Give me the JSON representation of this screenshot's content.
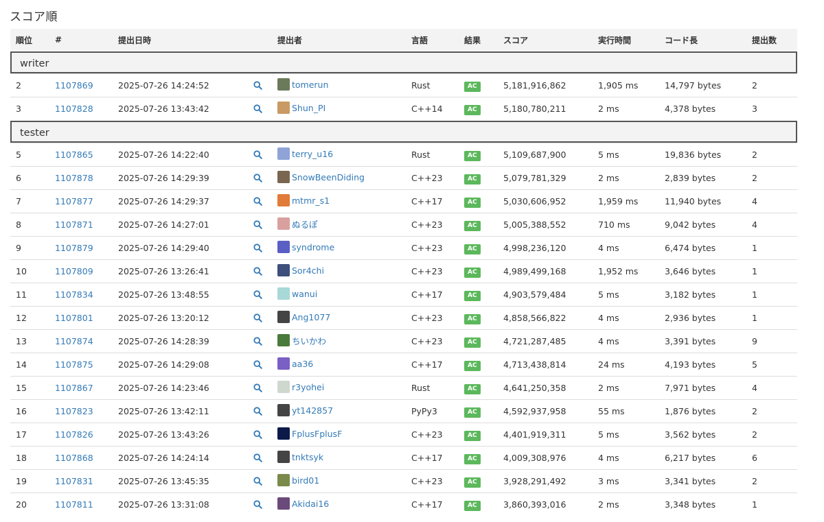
{
  "page_title": "スコア順",
  "columns": [
    "順位",
    "#",
    "提出日時",
    "",
    "提出者",
    "言語",
    "結果",
    "スコア",
    "実行時間",
    "コード長",
    "提出数"
  ],
  "groups": [
    {
      "label": "writer",
      "rows": [
        {
          "rank": "2",
          "id": "1107869",
          "date": "2025-07-26 14:24:52",
          "user": "tomerun",
          "avatar_color": "#6b7a5a",
          "lang": "Rust",
          "result": "AC",
          "score": "5,181,916,862",
          "time": "1,905 ms",
          "length": "14,797 bytes",
          "count": "2"
        },
        {
          "rank": "3",
          "id": "1107828",
          "date": "2025-07-26 13:43:42",
          "user": "Shun_PI",
          "avatar_color": "#c99a63",
          "lang": "C++14",
          "result": "AC",
          "score": "5,180,780,211",
          "time": "2 ms",
          "length": "4,378 bytes",
          "count": "3"
        }
      ]
    },
    {
      "label": "tester",
      "rows": [
        {
          "rank": "5",
          "id": "1107865",
          "date": "2025-07-26 14:22:40",
          "user": "terry_u16",
          "avatar_color": "#8fa3d6",
          "lang": "Rust",
          "result": "AC",
          "score": "5,109,687,900",
          "time": "5 ms",
          "length": "19,836 bytes",
          "count": "2"
        },
        {
          "rank": "6",
          "id": "1107878",
          "date": "2025-07-26 14:29:39",
          "user": "SnowBeenDiding",
          "avatar_color": "#7a6650",
          "lang": "C++23",
          "result": "AC",
          "score": "5,079,781,329",
          "time": "2 ms",
          "length": "2,839 bytes",
          "count": "2"
        },
        {
          "rank": "7",
          "id": "1107877",
          "date": "2025-07-26 14:29:37",
          "user": "mtmr_s1",
          "avatar_color": "#e07b39",
          "lang": "C++17",
          "result": "AC",
          "score": "5,030,606,952",
          "time": "1,959 ms",
          "length": "11,940 bytes",
          "count": "4"
        },
        {
          "rank": "8",
          "id": "1107871",
          "date": "2025-07-26 14:27:01",
          "user": "ぬるぽ",
          "avatar_color": "#d9a0a0",
          "lang": "C++23",
          "result": "AC",
          "score": "5,005,388,552",
          "time": "710 ms",
          "length": "9,042 bytes",
          "count": "4"
        },
        {
          "rank": "9",
          "id": "1107879",
          "date": "2025-07-26 14:29:40",
          "user": "syndrome",
          "avatar_color": "#5a5fc4",
          "lang": "C++23",
          "result": "AC",
          "score": "4,998,236,120",
          "time": "4 ms",
          "length": "6,474 bytes",
          "count": "1"
        },
        {
          "rank": "10",
          "id": "1107809",
          "date": "2025-07-26 13:26:41",
          "user": "Sor4chi",
          "avatar_color": "#3d4f7a",
          "lang": "C++23",
          "result": "AC",
          "score": "4,989,499,168",
          "time": "1,952 ms",
          "length": "3,646 bytes",
          "count": "1"
        },
        {
          "rank": "11",
          "id": "1107834",
          "date": "2025-07-26 13:48:55",
          "user": "wanui",
          "avatar_color": "#a8d8d8",
          "lang": "C++17",
          "result": "AC",
          "score": "4,903,579,484",
          "time": "5 ms",
          "length": "3,182 bytes",
          "count": "1"
        },
        {
          "rank": "12",
          "id": "1107801",
          "date": "2025-07-26 13:20:12",
          "user": "Ang1077",
          "avatar_color": "#444444",
          "lang": "C++23",
          "result": "AC",
          "score": "4,858,566,822",
          "time": "4 ms",
          "length": "2,936 bytes",
          "count": "1"
        },
        {
          "rank": "13",
          "id": "1107874",
          "date": "2025-07-26 14:28:39",
          "user": "ちいかわ",
          "avatar_color": "#4a7a3a",
          "lang": "C++23",
          "result": "AC",
          "score": "4,721,287,485",
          "time": "4 ms",
          "length": "3,391 bytes",
          "count": "9"
        },
        {
          "rank": "14",
          "id": "1107875",
          "date": "2025-07-26 14:29:08",
          "user": "aa36",
          "avatar_color": "#7a5fc4",
          "lang": "C++17",
          "result": "AC",
          "score": "4,713,438,814",
          "time": "24 ms",
          "length": "4,193 bytes",
          "count": "5"
        },
        {
          "rank": "15",
          "id": "1107867",
          "date": "2025-07-26 14:23:46",
          "user": "r3yohei",
          "avatar_color": "#cfd8cf",
          "lang": "Rust",
          "result": "AC",
          "score": "4,641,250,358",
          "time": "2 ms",
          "length": "7,971 bytes",
          "count": "4"
        },
        {
          "rank": "16",
          "id": "1107823",
          "date": "2025-07-26 13:42:11",
          "user": "yt142857",
          "avatar_color": "#444444",
          "lang": "PyPy3",
          "result": "AC",
          "score": "4,592,937,958",
          "time": "55 ms",
          "length": "1,876 bytes",
          "count": "2"
        },
        {
          "rank": "17",
          "id": "1107826",
          "date": "2025-07-26 13:43:26",
          "user": "FplusFplusF",
          "avatar_color": "#0c1a4a",
          "lang": "C++23",
          "result": "AC",
          "score": "4,401,919,311",
          "time": "5 ms",
          "length": "3,562 bytes",
          "count": "2"
        },
        {
          "rank": "18",
          "id": "1107868",
          "date": "2025-07-26 14:24:14",
          "user": "tnktsyk",
          "avatar_color": "#444444",
          "lang": "C++17",
          "result": "AC",
          "score": "4,009,308,976",
          "time": "4 ms",
          "length": "6,217 bytes",
          "count": "6"
        },
        {
          "rank": "19",
          "id": "1107831",
          "date": "2025-07-26 13:45:35",
          "user": "bird01",
          "avatar_color": "#7a8a4a",
          "lang": "C++23",
          "result": "AC",
          "score": "3,928,291,492",
          "time": "3 ms",
          "length": "3,341 bytes",
          "count": "2"
        },
        {
          "rank": "20",
          "id": "1107811",
          "date": "2025-07-26 13:31:08",
          "user": "Akidai16",
          "avatar_color": "#6a4a7a",
          "lang": "C++17",
          "result": "AC",
          "score": "3,860,393,016",
          "time": "2 ms",
          "length": "3,348 bytes",
          "count": "1"
        }
      ]
    }
  ]
}
